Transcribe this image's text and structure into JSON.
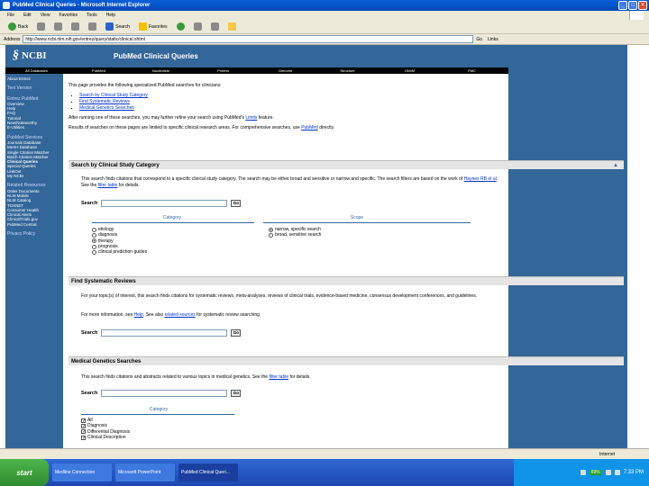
{
  "window": {
    "title": "PubMed Clinical Queries - Microsoft Internet Explorer",
    "menu": [
      "File",
      "Edit",
      "View",
      "Favorites",
      "Tools",
      "Help"
    ],
    "toolbar": {
      "back": "Back",
      "search": "Search",
      "favorites": "Favorites"
    },
    "address_label": "Address",
    "address_value": "http://www.ncbi.nlm.nih.gov/entrez/query/static/clinical.shtml",
    "go_label": "Go",
    "links_label": "Links"
  },
  "header": {
    "logo": "NCBI",
    "title": "PubMed Clinical Queries"
  },
  "nav": [
    "All Databases",
    "PubMed",
    "Nucleotide",
    "Protein",
    "Genome",
    "Structure",
    "OMIM",
    "PMC",
    "Journals",
    "Books"
  ],
  "sidebar": {
    "about": "About Entrez",
    "text_version": "Text Version",
    "entrez_head": "Entrez PubMed",
    "entrez_links": [
      "Overview",
      "Help",
      "FAQ",
      "Tutorial",
      "New/Noteworthy",
      "E-Utilities"
    ],
    "services_head": "PubMed Services",
    "services_links": [
      "Journals Database",
      "MeSH Database",
      "Single Citation Matcher",
      "Batch Citation Matcher",
      "Clinical Queries",
      "Special Queries",
      "LinkOut",
      "My NCBI"
    ],
    "resources_head": "Related Resources",
    "resources_links": [
      "Order Documents",
      "NLM Mobile",
      "NLM Catalog",
      "TOXNET",
      "Consumer Health",
      "Clinical Alerts",
      "ClinicalTrials.gov",
      "PubMed Central"
    ],
    "privacy": "Privacy Policy"
  },
  "intro": {
    "line1": "This page provides the following specialized PubMed searches for clinicians:",
    "bullets": [
      "Search by Clinical Study Category",
      "Find Systematic Reviews",
      "Medical Genetics Searches"
    ],
    "line2_a": "After running one of these searches, you may further refine your search using PubMed's ",
    "line2_link": "Limits",
    "line2_b": " feature.",
    "line3_a": "Results of searches on these pages are limited to specific clinical research areas. For comprehensive searches, use ",
    "line3_link": "PubMed",
    "line3_b": " directly."
  },
  "sections": {
    "study_category": {
      "title": "Search by Clinical Study Category",
      "text_a": "This search finds citations that correspond to a specific clinical study category. The search may be either broad and sensitive or narrow and specific. The search filters are based on the work of ",
      "text_link1": "Haynes RB et al",
      "text_b": ". See the ",
      "text_link2": "filter table",
      "text_c": " for details.",
      "search_label": "Search",
      "go_label": "Go",
      "category_head": "Category",
      "scope_head": "Scope",
      "categories": [
        "etiology",
        "diagnosis",
        "therapy",
        "prognosis",
        "clinical prediction guides"
      ],
      "scopes": [
        "narrow, specific search",
        "broad, sensitive search"
      ]
    },
    "systematic": {
      "title": "Find Systematic Reviews",
      "text": "For your topic(s) of interest, this search finds citations for systematic reviews, meta-analyses, reviews of clinical trials, evidence-based medicine, consensus development conferences, and guidelines.",
      "more_a": "For more information, see ",
      "more_link1": "Help",
      "more_b": ". See also ",
      "more_link2": "related sources",
      "more_c": " for systematic review searching",
      "search_label": "Search",
      "go_label": "Go"
    },
    "genetics": {
      "title": "Medical Genetics Searches",
      "text_a": "This search finds citations and abstracts related to various topics in medical genetics. See the ",
      "text_link": "filter table",
      "text_b": " for details.",
      "search_label": "Search",
      "go_label": "Go",
      "category_head": "Category",
      "categories": [
        "All",
        "Diagnosis",
        "Differential Diagnosis",
        "Clinical Description"
      ]
    }
  },
  "status": {
    "left": "",
    "zone": "Internet"
  },
  "taskbar": {
    "start": "start",
    "tasks": [
      "Medline Connection",
      "Microsoft PowerPoint",
      "PubMed Clinical Queri..."
    ],
    "battery": "69%",
    "time": "7:33 PM"
  }
}
